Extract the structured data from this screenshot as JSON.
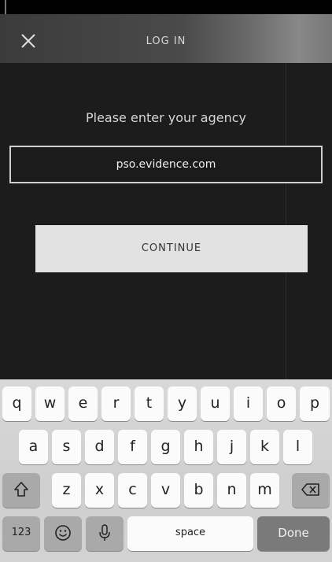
{
  "nav": {
    "title": "LOG IN",
    "close_icon": "close-icon"
  },
  "form": {
    "prompt": "Please enter your agency",
    "agency_value": "pso.evidence.com",
    "continue_label": "CONTINUE"
  },
  "keyboard": {
    "row1": [
      "q",
      "w",
      "e",
      "r",
      "t",
      "y",
      "u",
      "i",
      "o",
      "p"
    ],
    "row2": [
      "a",
      "s",
      "d",
      "f",
      "g",
      "h",
      "j",
      "k",
      "l"
    ],
    "row3": [
      "z",
      "x",
      "c",
      "v",
      "b",
      "n",
      "m"
    ],
    "numbers_label": "123",
    "space_label": "space",
    "done_label": "Done",
    "shift_icon": "shift-icon",
    "backspace_icon": "backspace-icon",
    "emoji_icon": "emoji-icon",
    "mic_icon": "microphone-icon"
  },
  "colors": {
    "background": "#1c1c1c",
    "button": "#e2e2e2",
    "keyboard": "#d3d3d3"
  }
}
